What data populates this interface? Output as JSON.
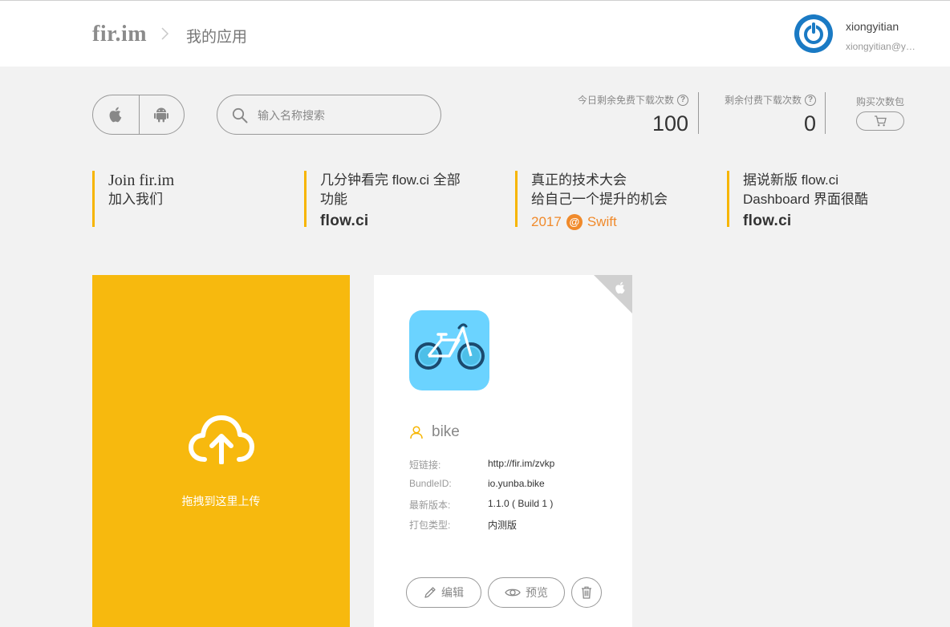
{
  "header": {
    "logo": "fir.im",
    "breadcrumb": "我的应用",
    "user": {
      "name": "xiongyitian",
      "email": "xiongyitian@y…"
    }
  },
  "toolbar": {
    "platforms": [
      "ios",
      "android"
    ],
    "search_placeholder": "输入名称搜索"
  },
  "stats": {
    "free_label": "今日剩余免费下载次数",
    "free_value": "100",
    "paid_label": "剩余付费下载次数",
    "paid_value": "0",
    "buy_label": "购买次数包"
  },
  "banners": [
    {
      "line1": "Join fir.im",
      "line2": "加入我们"
    },
    {
      "line1": "几分钟看完 flow.ci 全部",
      "line2": "功能",
      "brand": "flow.ci"
    },
    {
      "line1": "真正的技术大会",
      "line2": "给自己一个提升的机会",
      "year": "2017",
      "tag": "Swift"
    },
    {
      "line1": "据说新版 flow.ci",
      "line2": "Dashboard 界面很酷",
      "brand": "flow.ci"
    }
  ],
  "upload": {
    "label": "拖拽到这里上传"
  },
  "app": {
    "name": "bike",
    "platform": "ios",
    "info": [
      {
        "key": "短链接:",
        "value": "http://fir.im/zvkp"
      },
      {
        "key": "BundleID:",
        "value": "io.yunba.bike"
      },
      {
        "key": "最新版本:",
        "value": "1.1.0 ( Build 1 )"
      },
      {
        "key": "打包类型:",
        "value": "内测版"
      }
    ],
    "edit_label": "编辑",
    "preview_label": "预览"
  },
  "colors": {
    "accent": "#f7b90e",
    "orange": "#f08a2b",
    "avatar": "#1a7ac4",
    "app_icon_bg": "#6bd3ff"
  }
}
